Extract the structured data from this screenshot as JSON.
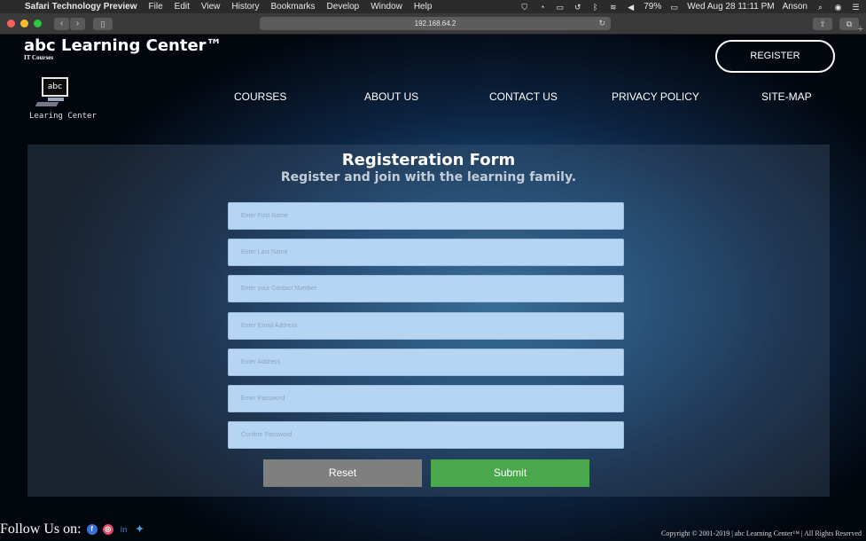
{
  "menubar": {
    "app": "Safari Technology Preview",
    "items": [
      "File",
      "Edit",
      "View",
      "History",
      "Bookmarks",
      "Develop",
      "Window",
      "Help"
    ],
    "battery": "79%",
    "datetime": "Wed Aug 28  11:11 PM",
    "user": "Anson"
  },
  "browser": {
    "url": "192.168.64.2"
  },
  "site": {
    "title": "abc Learning Center™",
    "subtitle": "IT Courses",
    "logo_screen_text": "abc",
    "logo_caption": "Learing Center",
    "register_label": "REGISTER",
    "nav": [
      "COURSES",
      "ABOUT US",
      "CONTACT US",
      "PRIVACY POLICY",
      "SITE-MAP"
    ]
  },
  "form": {
    "title": "Registeration Form",
    "subtitle": "Register and join with the learning family.",
    "fields": [
      "Enter First Name",
      "Enter Last Name",
      "Enter your Contact Number",
      "Enter Email Address",
      "Enter Address",
      "Enter Password",
      "Confirm Password"
    ],
    "reset_label": "Reset",
    "submit_label": "Submit"
  },
  "footer": {
    "follow_label": "Follow Us on:",
    "social": [
      "facebook-icon",
      "instagram-icon",
      "linkedin-icon",
      "twitter-icon"
    ],
    "copyright": "Copyright © 2001-2019 | abc Learning Center™ | All Rights Reserved"
  },
  "colors": {
    "field_bg": "#b5d5f3",
    "reset_bg": "#7f7f7f",
    "submit_bg": "#49a84b"
  }
}
